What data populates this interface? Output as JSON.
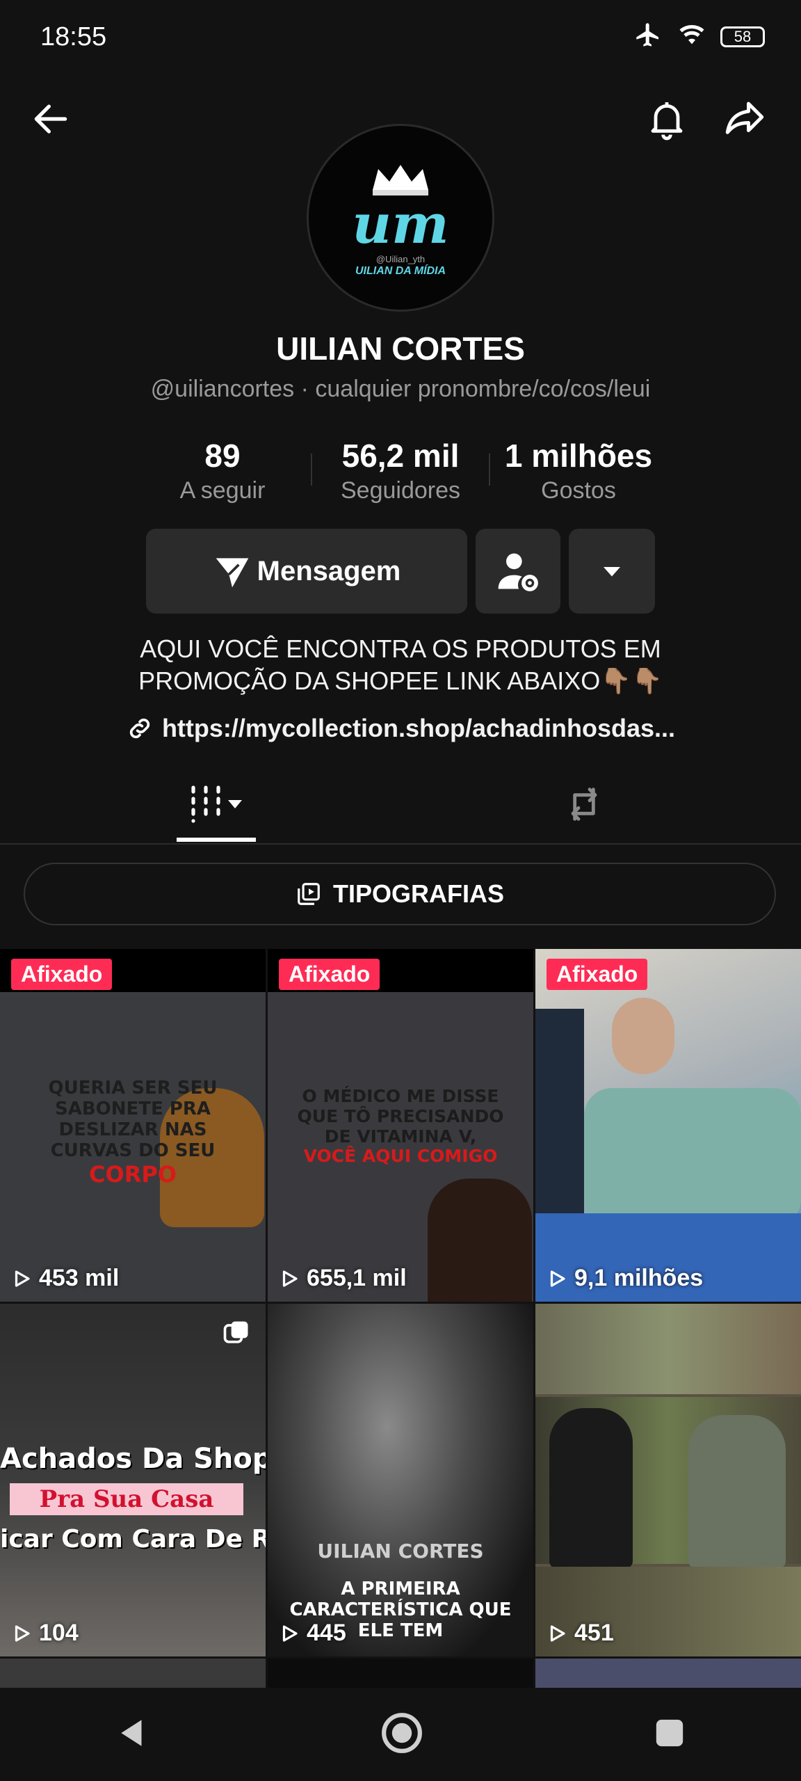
{
  "status": {
    "time": "18:55",
    "battery": "58"
  },
  "profile": {
    "name": "UILIAN CORTES",
    "handle_line": "@uiliancortes · cualquier pronombre/co/cos/leui",
    "avatar_text": "UILIAN DA MÍDIA",
    "avatar_handle": "@Uilian_yth"
  },
  "stats": [
    {
      "value": "89",
      "label": "A seguir"
    },
    {
      "value": "56,2 mil",
      "label": "Seguidores"
    },
    {
      "value": "1 milhões",
      "label": "Gostos"
    }
  ],
  "actions": {
    "message_label": "Mensagem"
  },
  "bio": {
    "line1": "AQUI VOCÊ ENCONTRA OS PRODUTOS EM",
    "line2": "PROMOÇÃO DA SHOPEE LINK ABAIXO👇🏽👇🏽",
    "link": "https://mycollection.shop/achadinhosdas..."
  },
  "playlist": {
    "label": "TIPOGRAFIAS"
  },
  "videos": [
    {
      "pinned": true,
      "pin_label": "Afixado",
      "views": "453 mil",
      "caption_lines": [
        "QUERIA SER SEU",
        "SABONETE PRA",
        "DESLIZAR NAS",
        "CURVAS DO SEU",
        "CORPO"
      ]
    },
    {
      "pinned": true,
      "pin_label": "Afixado",
      "views": "655,1 mil",
      "caption_lines": [
        "O MÉDICO ME DISSE",
        "QUE TÔ PRECISANDO",
        "DE VITAMINA V,",
        "VOCÊ AQUI COMIGO"
      ]
    },
    {
      "pinned": true,
      "pin_label": "Afixado",
      "views": "9,1 milhões",
      "caption_lines": []
    },
    {
      "pinned": false,
      "views": "104",
      "caption_lines": [
        "Achados Da Shopee",
        "Pra Sua Casa",
        "icar Com Cara De Rica"
      ]
    },
    {
      "pinned": false,
      "views": "445",
      "caption_lines": [
        "UILIAN CORTES",
        "A PRIMEIRA",
        "CARACTERÍSTICA QUE",
        "ELE TEM"
      ]
    },
    {
      "pinned": false,
      "views": "451",
      "caption_lines": []
    }
  ],
  "colors": {
    "background": "#121212",
    "pin_badge": "#fe2c55",
    "button": "#2b2b2b"
  }
}
